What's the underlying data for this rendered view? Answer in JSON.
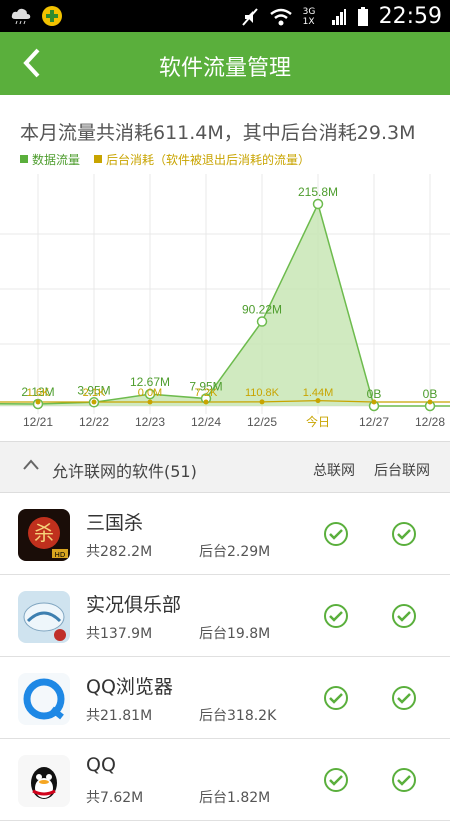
{
  "status_bar": {
    "time": "22:59",
    "network": "3G 1X"
  },
  "app_bar": {
    "title": "软件流量管理"
  },
  "summary": {
    "text": "本月流量共消耗611.4M，其中后台消耗29.3M"
  },
  "legend": {
    "data_label": "数据流量",
    "bg_label": "后台消耗（软件被退出后消耗的流量）",
    "data_color": "#5aaf3c",
    "bg_color": "#c8a400"
  },
  "chart_data": {
    "type": "area",
    "categories": [
      "12/21",
      "12/22",
      "12/23",
      "12/24",
      "12/25",
      "今日",
      "12/27",
      "12/28"
    ],
    "series": [
      {
        "values_label": [
          "2.13M",
          "3.95M",
          "12.67M",
          "7.95M",
          "90.22M",
          "215.8M",
          "0B",
          "0B"
        ],
        "values": [
          2.13,
          3.95,
          12.67,
          7.95,
          90.22,
          215.8,
          0,
          0
        ]
      },
      {
        "values_label": [
          "1.6K",
          "2.1K",
          "0.0M",
          "7.2K",
          "110.8K",
          "1.44M",
          "",
          ""
        ],
        "values": [
          0.0016,
          0.0021,
          0.0,
          0.0072,
          0.1108,
          1.44,
          0,
          0
        ]
      }
    ]
  },
  "section": {
    "title": "允许联网的软件(51)",
    "col_total": "总联网",
    "col_bg": "后台联网"
  },
  "apps": [
    {
      "name": "三国杀",
      "total": "共282.2M",
      "bg": "后台2.29M",
      "icon": "sanguosha-icon"
    },
    {
      "name": "实况俱乐部",
      "total": "共137.9M",
      "bg": "后台19.8M",
      "icon": "pes-club-icon"
    },
    {
      "name": "QQ浏览器",
      "total": "共21.81M",
      "bg": "后台318.2K",
      "icon": "qq-browser-icon"
    },
    {
      "name": "QQ",
      "total": "共7.62M",
      "bg": "后台1.82M",
      "icon": "qq-icon"
    }
  ]
}
